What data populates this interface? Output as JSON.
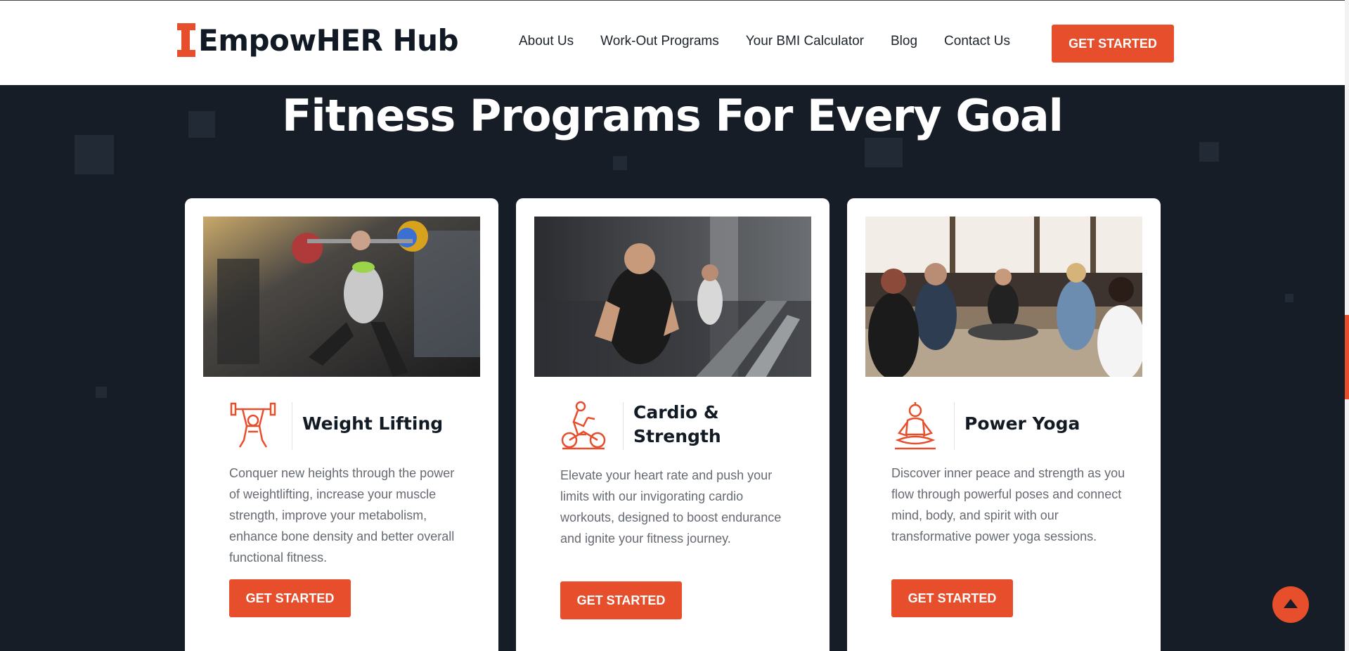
{
  "header": {
    "logo_text": "EmpowHER Hub",
    "nav": [
      "About Us",
      "Work-Out Programs",
      "Your BMI Calculator",
      "Blog",
      "Contact Us"
    ],
    "cta_label": "GET STARTED"
  },
  "section": {
    "title": "Fitness Programs For Every Goal"
  },
  "cards": [
    {
      "title": "Weight Lifting",
      "text": "Conquer new heights through the power of weightlifting, increase your muscle strength, improve your metabolism, enhance bone density and better overall functional fitness.",
      "button": "GET STARTED",
      "icon": "weightlifter-icon"
    },
    {
      "title": "Cardio & Strength",
      "text": "Elevate your heart rate and push your limits with our invigorating cardio workouts, designed to boost endurance and ignite your fitness journey.",
      "button": "GET STARTED",
      "icon": "exercise-bike-icon"
    },
    {
      "title": "Power Yoga",
      "text": "Discover inner peace and strength as you flow through powerful poses and connect mind, body, and spirit with our transformative power yoga sessions.",
      "button": "GET STARTED",
      "icon": "meditation-icon"
    }
  ],
  "colors": {
    "accent": "#e74e2b",
    "dark_background": "#161d26",
    "heading": "#121a24",
    "body_text": "#666b72"
  }
}
